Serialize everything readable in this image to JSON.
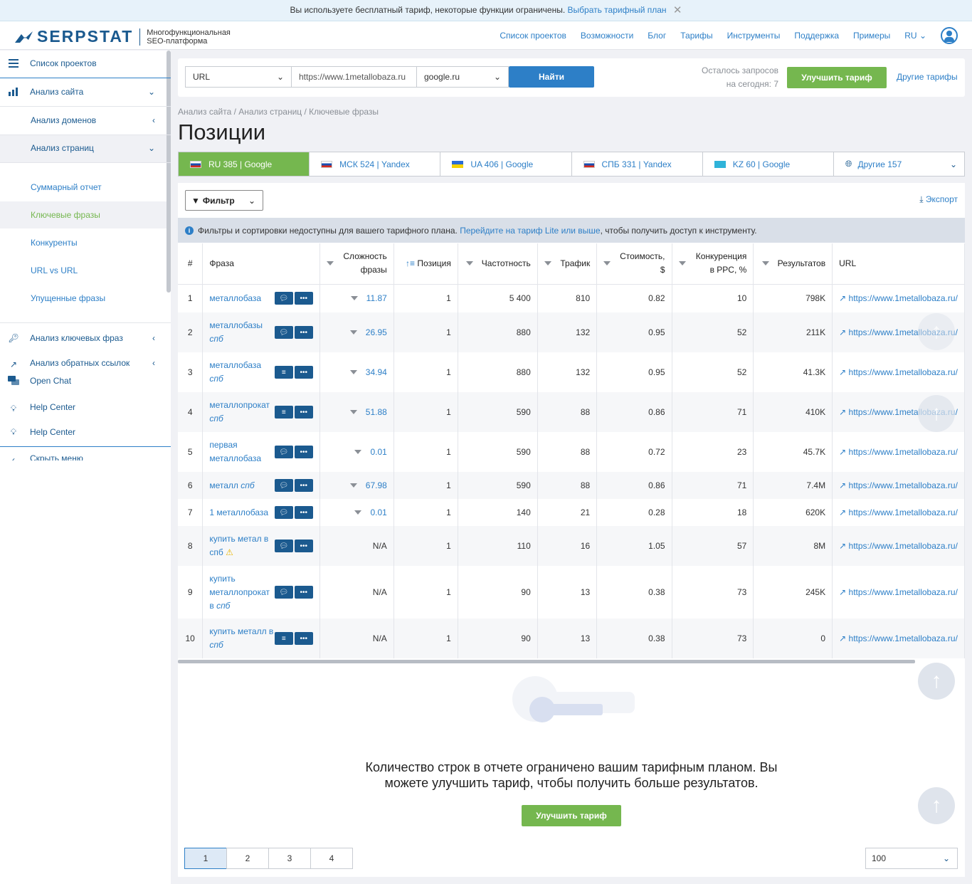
{
  "banner": {
    "text": "Вы используете бесплатный тариф, некоторые функции ограничены.",
    "link": "Выбрать тарифный план",
    "close": "✕"
  },
  "brand": {
    "name": "SERPSTAT",
    "tagline1": "Многофункциональная",
    "tagline2": "SEO-платформа"
  },
  "topnav": [
    "Список проектов",
    "Возможности",
    "Блог",
    "Тарифы",
    "Инструменты",
    "Поддержка",
    "Примеры"
  ],
  "lang": "RU",
  "sidebar": {
    "projects": "Список проектов",
    "site_analysis": "Анализ сайта",
    "domain_analysis": "Анализ доменов",
    "page_analysis": "Анализ страниц",
    "summary": "Суммарный отчет",
    "keywords": "Ключевые фразы",
    "competitors": "Конкуренты",
    "url_vs_url": "URL vs URL",
    "missed": "Упущенные фразы",
    "kw_analysis": "Анализ ключевых фраз",
    "backlinks": "Анализ обратных ссылок",
    "open_chat": "Open Chat",
    "help_center_hidden": "Help Center",
    "help_center": "Help Center",
    "hide_menu": "Скрыть меню"
  },
  "search": {
    "type": "URL",
    "query": "https://www.1metallobaza.ru",
    "engine": "google.ru",
    "go": "Найти",
    "remaining": "Осталось запросов",
    "today": "на сегодня: 7",
    "upgrade": "Улучшить тариф",
    "other": "Другие тарифы"
  },
  "breadcrumb": "Анализ сайта / Анализ страниц / Ключевые фразы",
  "page_title": "Позиции",
  "db_tabs": [
    "RU 385 | Google",
    "МСК 524 | Yandex",
    "UA 406 | Google",
    "СПБ 331 | Yandex",
    "KZ 60 | Google",
    "Другие 157"
  ],
  "toolbar": {
    "filter": "Фильтр",
    "export": "Экспорт"
  },
  "notice": {
    "text": "Фильтры и сортировки недоступны для вашего тарифного плана.",
    "link": "Перейдите на тариф Lite или выше",
    "tail": ", чтобы получить доступ к инструменту."
  },
  "columns": {
    "num": "#",
    "phrase": "Фраза",
    "difficulty1": "Сложность",
    "difficulty2": "фразы",
    "position": "Позиция",
    "frequency": "Частотность",
    "traffic": "Трафик",
    "cost1": "Стоимость,",
    "cost2": "$",
    "ppc1": "Конкуренция",
    "ppc2": "в PPC, %",
    "results": "Результатов",
    "url": "URL"
  },
  "rows": [
    {
      "n": "1",
      "kw": "металлобаза",
      "kw2": "",
      "diff": "11.87",
      "pos": "1",
      "freq": "5 400",
      "traffic": "810",
      "cost": "0.82",
      "ppc": "10",
      "results": "798K",
      "url": "https://www.1metallobaza.ru/"
    },
    {
      "n": "2",
      "kw": "металлобазы",
      "kw2": "спб",
      "diff": "26.95",
      "pos": "1",
      "freq": "880",
      "traffic": "132",
      "cost": "0.95",
      "ppc": "52",
      "results": "211K",
      "url": "https://www.1metallobaza.ru/"
    },
    {
      "n": "3",
      "kw": "металлобаза",
      "kw2": "спб",
      "diff": "34.94",
      "pos": "1",
      "freq": "880",
      "traffic": "132",
      "cost": "0.95",
      "ppc": "52",
      "results": "41.3K",
      "url": "https://www.1metallobaza.ru/"
    },
    {
      "n": "4",
      "kw": "металлопрокат",
      "kw2": "спб",
      "diff": "51.88",
      "pos": "1",
      "freq": "590",
      "traffic": "88",
      "cost": "0.86",
      "ppc": "71",
      "results": "410K",
      "url": "https://www.1metallobaza.ru/"
    },
    {
      "n": "5",
      "kw": "первая металлобаза",
      "kw2": "",
      "diff": "0.01",
      "pos": "1",
      "freq": "590",
      "traffic": "88",
      "cost": "0.72",
      "ppc": "23",
      "results": "45.7K",
      "url": "https://www.1metallobaza.ru/"
    },
    {
      "n": "6",
      "kw": "металл",
      "kw2": "спб",
      "diff": "67.98",
      "pos": "1",
      "freq": "590",
      "traffic": "88",
      "cost": "0.86",
      "ppc": "71",
      "results": "7.4M",
      "url": "https://www.1metallobaza.ru/"
    },
    {
      "n": "7",
      "kw": "1 металлобаза",
      "kw2": "",
      "diff": "0.01",
      "pos": "1",
      "freq": "140",
      "traffic": "21",
      "cost": "0.28",
      "ppc": "18",
      "results": "620K",
      "url": "https://www.1metallobaza.ru/"
    },
    {
      "n": "8",
      "kw": "купить метал в спб",
      "kw2": "",
      "diff": "N/A",
      "pos": "1",
      "freq": "110",
      "traffic": "16",
      "cost": "1.05",
      "ppc": "57",
      "results": "8M",
      "url": "https://www.1metallobaza.ru/"
    },
    {
      "n": "9",
      "kw": "купить металлопрокат в",
      "kw2": "спб",
      "diff": "N/A",
      "pos": "1",
      "freq": "90",
      "traffic": "13",
      "cost": "0.38",
      "ppc": "73",
      "results": "245K",
      "url": "https://www.1metallobaza.ru/"
    },
    {
      "n": "10",
      "kw": "купить металл в",
      "kw2": "спб",
      "diff": "N/A",
      "pos": "1",
      "freq": "90",
      "traffic": "13",
      "cost": "0.38",
      "ppc": "73",
      "results": "0",
      "url": "https://www.1metallobaza.ru/"
    }
  ],
  "limit": {
    "line1": "Количество строк в отчете ограничено вашим тарифным планом. Вы",
    "line2": "можете улучшить тариф, чтобы получить больше результатов.",
    "button": "Улучшить тариф"
  },
  "pager": {
    "pages": [
      "1",
      "2",
      "3",
      "4"
    ],
    "per_page": "100"
  },
  "colors": {
    "accent": "#2d7fc7",
    "green": "#75b74f",
    "navy": "#1b5a8f"
  }
}
